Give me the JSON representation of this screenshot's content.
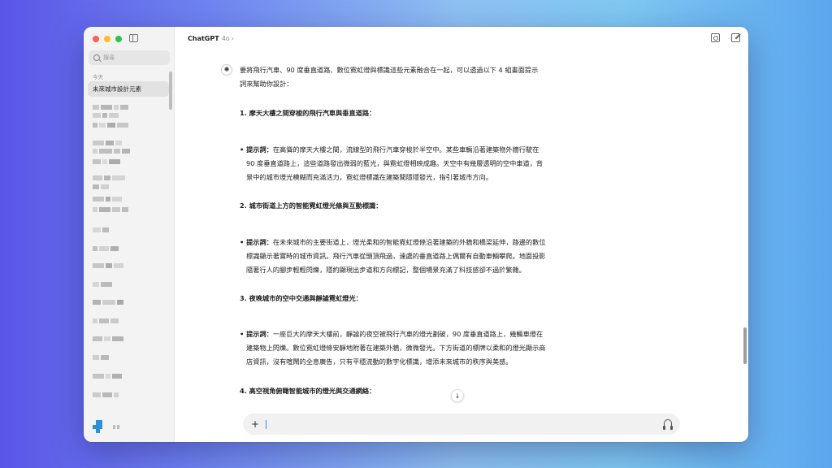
{
  "sidebar": {
    "search_placeholder": "搜尋",
    "section_today": "今天",
    "active_chat": "未來城市設計元素"
  },
  "header": {
    "app_name": "ChatGPT",
    "model_version": "4o",
    "chevron": "›"
  },
  "message": {
    "intro_line1": "要將飛行汽車、90 度垂直道路、數位霓虹燈與標識這些元素融合在一起，可以透過以下 4 組畫面提示",
    "intro_line2": "詞來幫助你設計：",
    "sections": [
      {
        "heading": "1. 摩天大樓之間穿梭的飛行汽車與垂直道路：",
        "bullet_label": "• 提示詞：",
        "line1": "在高聳的摩天大樓之間，流線型的飛行汽車穿梭於半空中。某些車輛沿著建築物外牆行駛在",
        "line2": "90 度垂直道路上，這些道路發出微弱的藍光，與霓虹燈相映成趣。天空中有幾層透明的空中車道，背",
        "line3": "景中的城市燈光模糊而充滿活力，霓虹燈標識在建築間隱隱發光，指引著城市方向。"
      },
      {
        "heading": "2. 城市街道上方的智能霓虹燈光條與互動標識：",
        "bullet_label": "• 提示詞：",
        "line1": "在未來城市的主要街道上，燈光柔和的智能霓虹燈條沿著建築的外牆和橋梁延伸，路邊的數位",
        "line2": "標識顯示著實時的城市資訊。飛行汽車從頭頂飛過，遠處的垂直道路上偶爾有自動車輛攀爬。地面投影",
        "line3": "隨著行人的腳步輕輕閃爍，隱約顯現出步道和方向標記，整個場景充滿了科技感卻不過於繁雜。"
      },
      {
        "heading": "3. 夜晚城市的空中交通與靜謐霓虹燈光：",
        "bullet_label": "• 提示詞：",
        "line1": "一座巨大的摩天大樓前，靜謐的夜空被飛行汽車的燈光劃破，90 度垂直道路上，幾輛車燈在",
        "line2": "建築物上閃爍。數位霓虹燈條安靜地附著在建築外牆，微微發光。下方街道的標牌以柔和的燈光顯示商",
        "line3": "店資訊，沒有喧鬧的全息廣告，只有平穩流動的數字化標識，增添未來城市的秩序與美感。"
      },
      {
        "heading": "4. 高空視角俯瞰智能城市的燈光與交通網絡："
      }
    ]
  },
  "icons": {
    "gpt": "✺",
    "scroll_down": "↓",
    "plus": "+"
  }
}
